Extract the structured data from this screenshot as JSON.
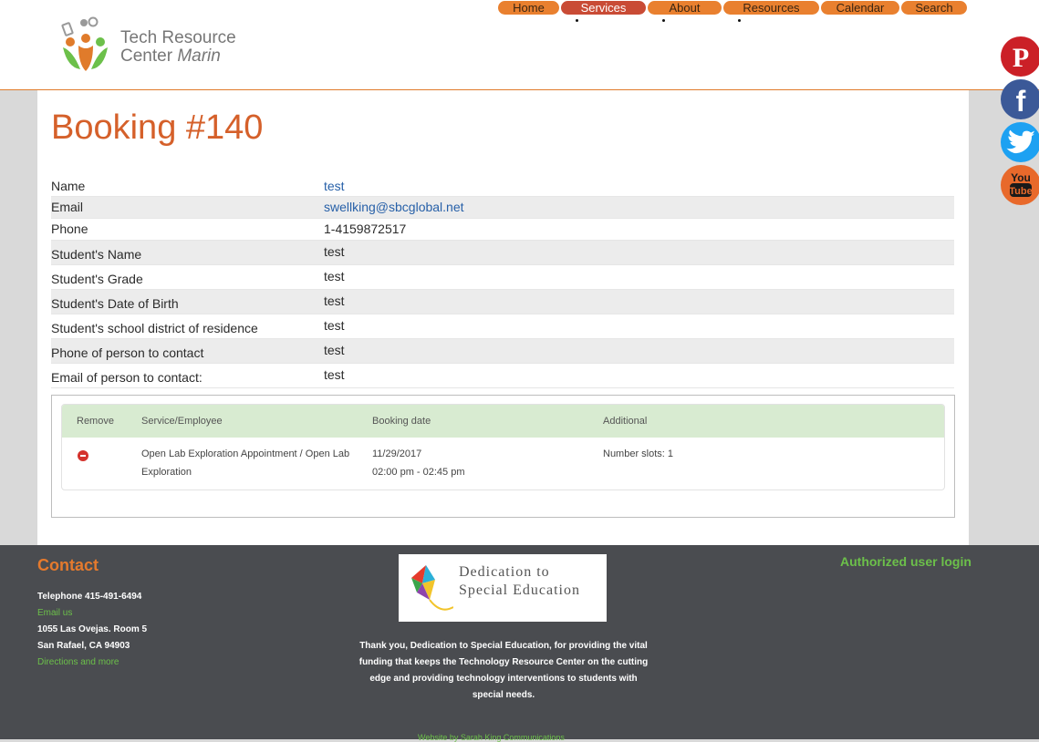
{
  "header": {
    "logo_line1": "Tech Resource",
    "logo_line2_a": "Center",
    "logo_line2_b": "Marin",
    "nav": [
      {
        "label": "Home"
      },
      {
        "label": "Services"
      },
      {
        "label": "About"
      },
      {
        "label": "Resources"
      },
      {
        "label": "Calendar"
      },
      {
        "label": "Search"
      }
    ],
    "active_item": "Services"
  },
  "social": [
    {
      "icon": "pinterest-icon",
      "color": "#cb2027"
    },
    {
      "icon": "facebook-icon",
      "color": "#3b5998"
    },
    {
      "icon": "twitter-icon",
      "color": "#1da1f2"
    },
    {
      "icon": "youtube-icon",
      "color": "#e8692b"
    }
  ],
  "booking": {
    "title": "Booking #140",
    "details": [
      {
        "label": "Name",
        "value": "test"
      },
      {
        "label": "Email",
        "value": "swellking@sbcglobal.net"
      },
      {
        "label": "Phone",
        "value": "1-4159872517"
      },
      {
        "label": "Student's Name",
        "value": "test"
      },
      {
        "label": "Student's Grade",
        "value": "test"
      },
      {
        "label": "Student's Date of Birth",
        "value": "test"
      },
      {
        "label": "Student's school district of residence",
        "value": "test"
      },
      {
        "label": "Phone of person to contact",
        "value": "test"
      },
      {
        "label": "Email of person to contact:",
        "value": "test"
      }
    ],
    "table": {
      "headers": [
        "Remove",
        "Service/Employee",
        "Booking date",
        "Additional"
      ],
      "row": {
        "service_line1": "Open Lab Exploration Appointment / Open Lab",
        "service_line2": "Exploration",
        "date": "11/29/2017",
        "time": "02:00 pm - 02:45 pm",
        "additional": "Number slots: 1"
      }
    }
  },
  "footer": {
    "contact_title": "Contact",
    "telephone": "Telephone 415-491-6494",
    "email_link": "Email us",
    "address1": "1055 Las Ovejas. Room 5",
    "address2": "San Rafael, CA 94903",
    "directions_link": "Directions and more",
    "sponsor_line1": "Dedication to",
    "sponsor_line2": "Special Education",
    "thanks": "Thank you, Dedication to Special Education, for providing the vital funding that keeps the Technology Resource Center on the cutting edge and providing technology interventions to students with special needs.",
    "auth_link": "Authorized user login",
    "credit": "Website by Sarah King Communications"
  },
  "colors": {
    "accent": "#e9802f",
    "active_nav": "#c94b35",
    "title": "#d5602a",
    "link": "#2760a8",
    "footer_bg": "#4a4c50",
    "footer_link": "#6cc04a",
    "table_head": "#d8ebd1"
  }
}
